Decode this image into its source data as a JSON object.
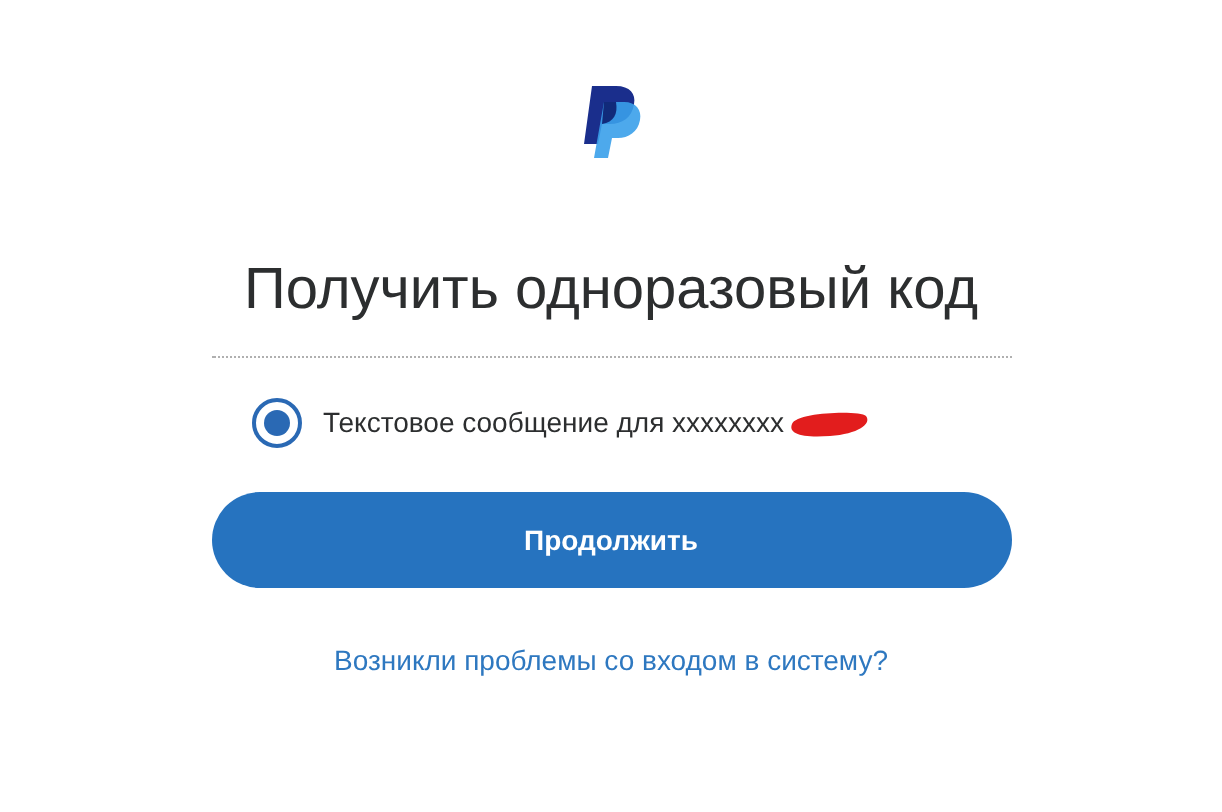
{
  "title": "Получить одноразовый код",
  "options": [
    {
      "label": "Текстовое сообщение для xxxxxxxx",
      "selected": true
    }
  ],
  "continue_button": "Продолжить",
  "help_link": "Возникли проблемы со входом в систему?"
}
